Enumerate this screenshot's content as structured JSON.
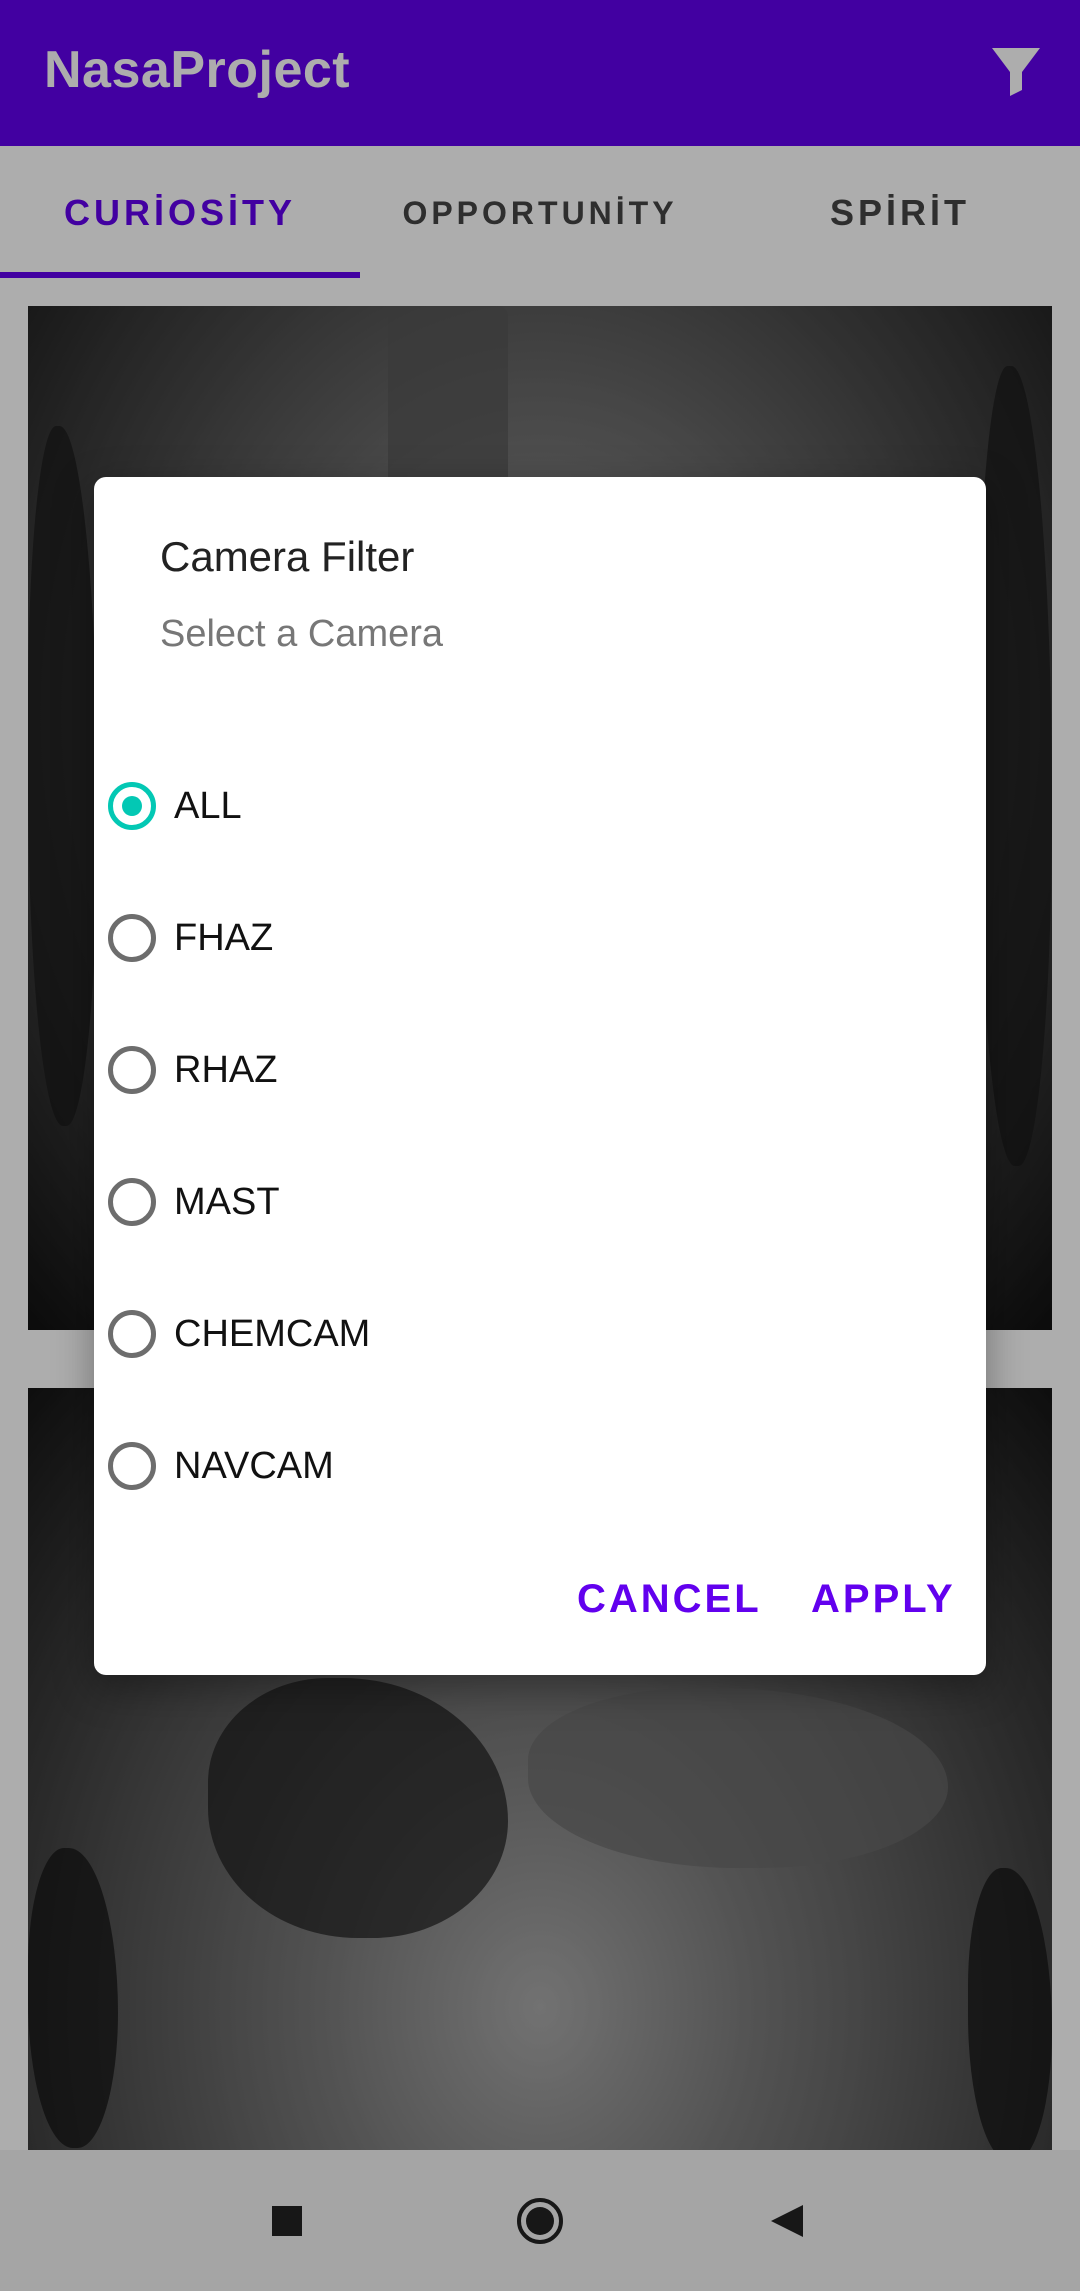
{
  "app": {
    "title": "NasaProject",
    "accent_color": "#6200ee",
    "filter_icon": "filter-icon"
  },
  "tabs": [
    {
      "label": "CURİOSİTY",
      "selected": true
    },
    {
      "label": "OPPORTUNİTY",
      "selected": false
    },
    {
      "label": "SPİRİT",
      "selected": false
    }
  ],
  "dialog": {
    "title": "Camera Filter",
    "subtitle": "Select a Camera",
    "options": [
      {
        "label": "ALL",
        "checked": true
      },
      {
        "label": "FHAZ",
        "checked": false
      },
      {
        "label": "RHAZ",
        "checked": false
      },
      {
        "label": "MAST",
        "checked": false
      },
      {
        "label": "CHEMCAM",
        "checked": false
      },
      {
        "label": "NAVCAM",
        "checked": false
      }
    ],
    "cancel_label": "CANCEL",
    "apply_label": "APPLY",
    "radio_color": "#03c8b4"
  },
  "navbar": {
    "icons": [
      "recents-square-icon",
      "home-circle-icon",
      "back-triangle-icon"
    ]
  }
}
